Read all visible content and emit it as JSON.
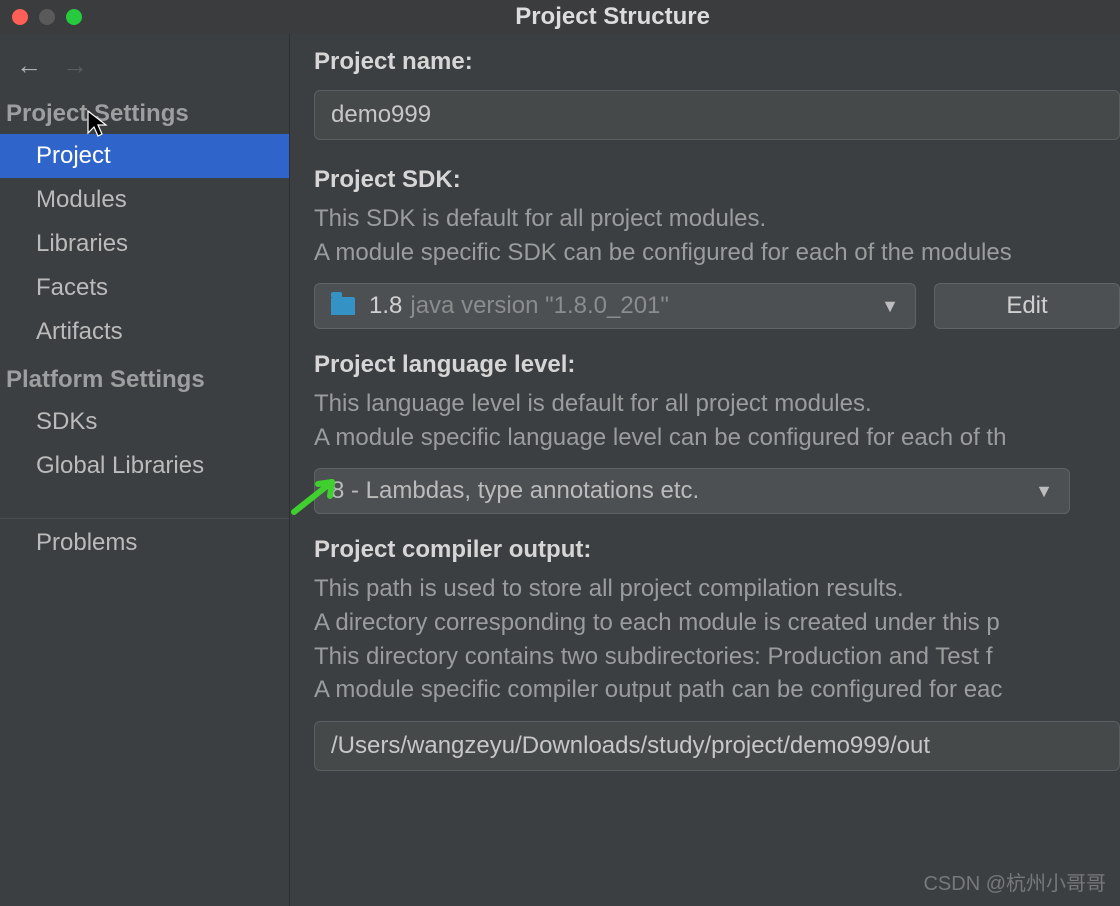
{
  "window": {
    "title": "Project Structure"
  },
  "sidebar": {
    "section1": "Project Settings",
    "section2": "Platform Settings",
    "items1": [
      {
        "label": "Project"
      },
      {
        "label": "Modules"
      },
      {
        "label": "Libraries"
      },
      {
        "label": "Facets"
      },
      {
        "label": "Artifacts"
      }
    ],
    "items2": [
      {
        "label": "SDKs"
      },
      {
        "label": "Global Libraries"
      }
    ],
    "problems": "Problems"
  },
  "project": {
    "name_label": "Project name:",
    "name_value": "demo999",
    "sdk_label": "Project SDK:",
    "sdk_desc1": "This SDK is default for all project modules.",
    "sdk_desc2": "A module specific SDK can be configured for each of the modules",
    "sdk_version": "1.8",
    "sdk_detail": "java version \"1.8.0_201\"",
    "edit_label": "Edit",
    "lang_label": "Project language level:",
    "lang_desc1": "This language level is default for all project modules.",
    "lang_desc2": "A module specific language level can be configured for each of th",
    "lang_value": "8 - Lambdas, type annotations etc.",
    "out_label": "Project compiler output:",
    "out_desc1": "This path is used to store all project compilation results.",
    "out_desc2": "A directory corresponding to each module is created under this p",
    "out_desc3": "This directory contains two subdirectories: Production and Test f",
    "out_desc4": "A module specific compiler output path can be configured for eac",
    "out_value": "/Users/wangzeyu/Downloads/study/project/demo999/out"
  },
  "watermark": "CSDN @杭州小哥哥"
}
